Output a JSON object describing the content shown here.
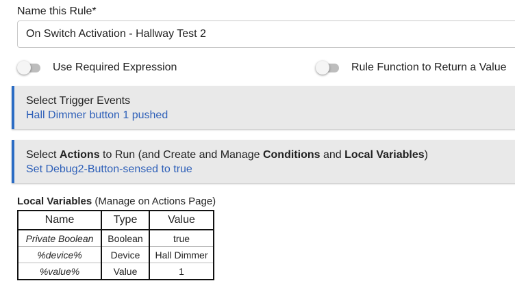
{
  "rule_name": {
    "label": "Name this Rule*",
    "value": "On Switch Activation - Hallway Test 2"
  },
  "toggles": [
    {
      "label": "Use Required Expression",
      "on": false
    },
    {
      "label": "Rule Function to Return a Value",
      "on": false
    }
  ],
  "trigger_section": {
    "title": "Select Trigger Events",
    "summary": "Hall Dimmer button 1 pushed"
  },
  "actions_section": {
    "title_parts": [
      "Select ",
      "Actions",
      " to Run (and Create and Manage ",
      "Conditions",
      " and ",
      "Local Variables",
      ")"
    ],
    "summary": "Set Debug2-Button-sensed to true"
  },
  "local_variables": {
    "heading": "Local Variables",
    "note": " (Manage on Actions Page)",
    "columns": [
      "Name",
      "Type",
      "Value"
    ],
    "rows": [
      [
        "Private Boolean",
        "Boolean",
        "true"
      ],
      [
        "%device%",
        "Device",
        "Hall Dimmer"
      ],
      [
        "%value%",
        "Value",
        "1"
      ]
    ]
  },
  "colors": {
    "accent": "#2b6cc4",
    "link": "#2d5fb8",
    "section_bg": "#e9e9e9"
  }
}
